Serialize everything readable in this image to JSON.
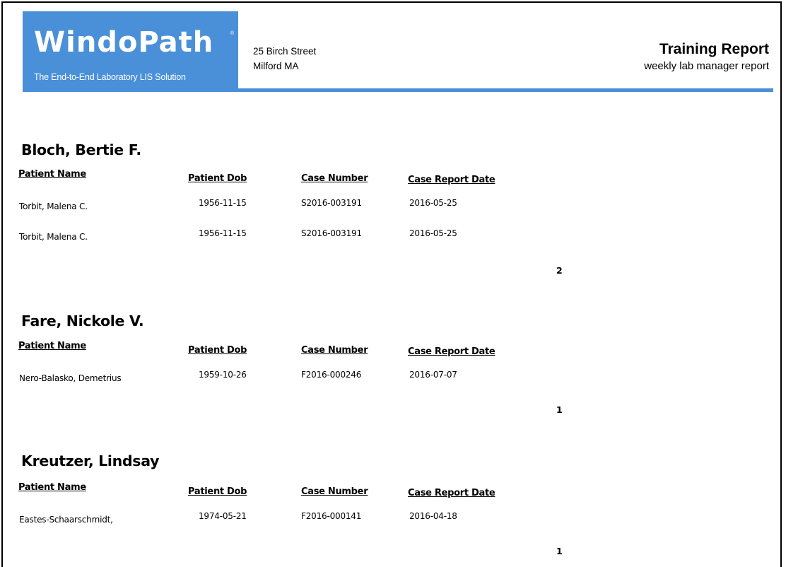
{
  "header": {
    "logo_text": "WindoPath",
    "logo_tm": "®",
    "tagline": "The End-to-End Laboratory LIS Solution",
    "address_line1": "25 Birch Street",
    "address_line2": "Milford MA",
    "report_title": "Training Report",
    "report_subtitle": "weekly lab manager report"
  },
  "colors": {
    "logo_blue": "#4a90d9",
    "rule_blue": "#4a8fdc"
  },
  "columns": {
    "patient_name": "Patient Name",
    "patient_dob": "Patient Dob",
    "case_number": "Case Number",
    "case_report_date": "Case Report Date"
  },
  "groups": [
    {
      "name": "Bloch, Bertie F.",
      "rows": [
        {
          "patient_name": "Torbit, Malena C.",
          "patient_dob": "1956-11-15",
          "case_number": "S2016-003191",
          "case_report_date": "2016-05-25"
        },
        {
          "patient_name": "Torbit, Malena C.",
          "patient_dob": "1956-11-15",
          "case_number": "S2016-003191",
          "case_report_date": "2016-05-25"
        }
      ],
      "count": "2"
    },
    {
      "name": "Fare, Nickole V.",
      "rows": [
        {
          "patient_name": "Nero-Balasko, Demetrius",
          "patient_dob": "1959-10-26",
          "case_number": "F2016-000246",
          "case_report_date": "2016-07-07"
        }
      ],
      "count": "1"
    },
    {
      "name": "Kreutzer, Lindsay",
      "rows": [
        {
          "patient_name": "Eastes-Schaarschmidt,",
          "patient_dob": "1974-05-21",
          "case_number": "F2016-000141",
          "case_report_date": "2016-04-18"
        }
      ],
      "count": "1"
    }
  ]
}
